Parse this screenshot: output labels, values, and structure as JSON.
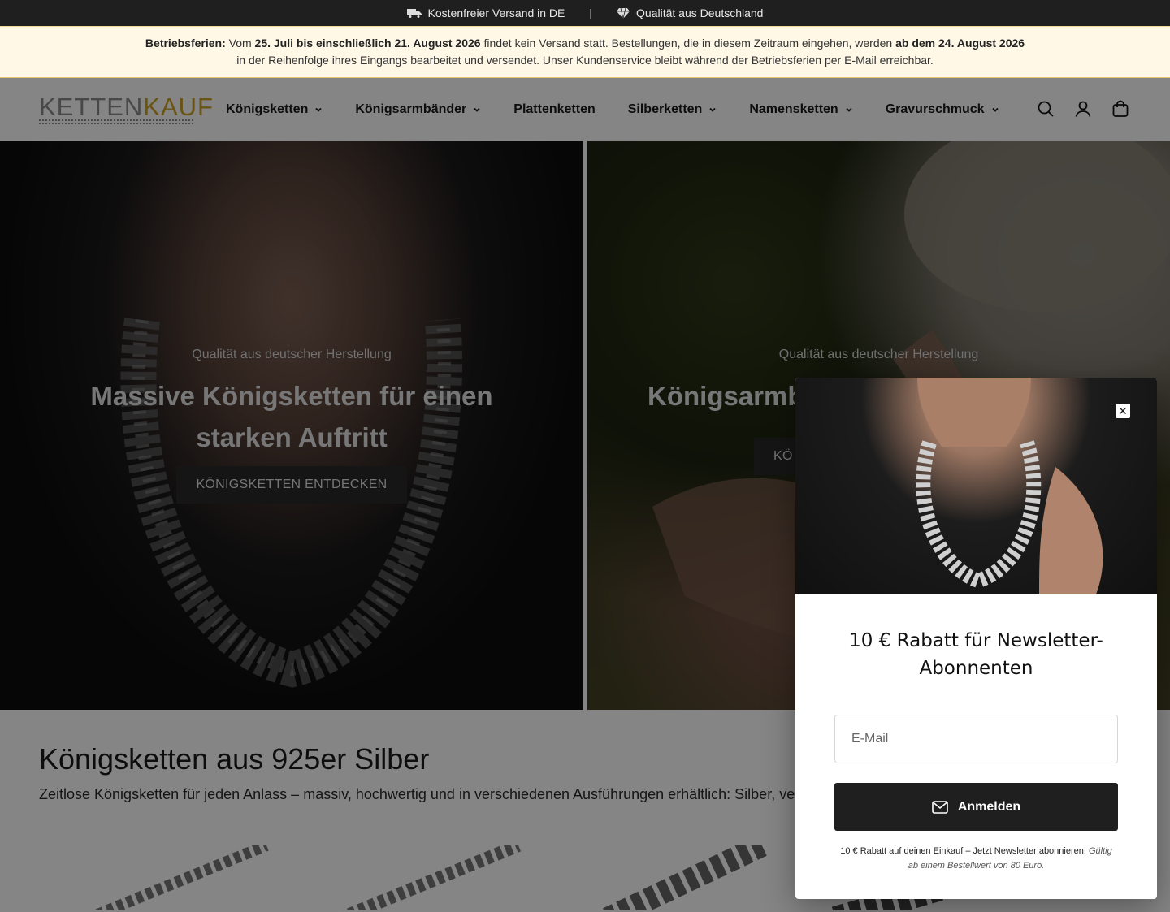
{
  "announcement": {
    "shipping": "Kostenfreier Versand in DE",
    "separator": "|",
    "quality": "Qualität aus Deutschland"
  },
  "notice": {
    "icon": "",
    "label": "Betriebsferien:",
    "t1": "Vom",
    "dates": "25. Juli bis einschließlich 21. August 2026",
    "t2": "findet kein Versand statt. Bestellungen, die in diesem Zeitraum eingehen, werden",
    "resume": "ab dem 24. August 2026",
    "t3": "in der Reihenfolge ihres Eingangs bearbeitet und versendet.",
    "icon2": "",
    "t4": "Unser Kundenservice bleibt während der Betriebsferien per E-Mail erreichbar."
  },
  "header": {
    "logo_part1": "KETTEN",
    "logo_part2": "KAUF",
    "nav": [
      "Königsketten",
      "Königsarmbänder",
      "Plattenketten",
      "Silberketten",
      "Namensketten",
      "Gravurschmuck"
    ]
  },
  "hero": {
    "left": {
      "sub": "Qualität aus deutscher Herstellung",
      "title": "Massive Königsketten für einen starken Auftritt",
      "button": "KÖNIGSKETTEN ENTDECKEN"
    },
    "right": {
      "sub": "Qualität aus deutscher Herstellung",
      "title": "Königsarmbä",
      "button": "KÖ"
    }
  },
  "section": {
    "title": "Königsketten aus 925er Silber",
    "text": "Zeitlose Königsketten für jeden Anlass – massiv, hochwertig und in verschiedenen Ausführungen erhältlich: Silber, vergol"
  },
  "popup": {
    "title": "10 € Rabatt für Newsletter-Abonnenten",
    "email_placeholder": "E-Mail",
    "submit": "Anmelden",
    "fine_bold": "10 € Rabatt auf deinen Einkauf – Jetzt Newsletter abonnieren!",
    "fine_italic": "Gültig ab einem Bestellwert von 80 Euro.",
    "close": "✕"
  }
}
